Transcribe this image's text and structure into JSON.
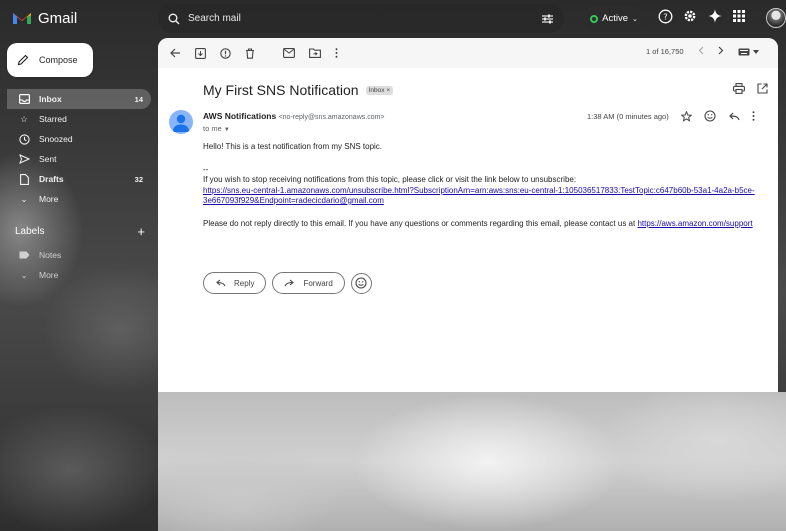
{
  "app": {
    "name": "Gmail"
  },
  "search": {
    "placeholder": "Search mail"
  },
  "status": {
    "label": "Active"
  },
  "sidebar": {
    "compose_label": "Compose",
    "items": [
      {
        "label": "Inbox",
        "count": "14"
      },
      {
        "label": "Starred",
        "count": ""
      },
      {
        "label": "Snoozed",
        "count": ""
      },
      {
        "label": "Sent",
        "count": ""
      },
      {
        "label": "Drafts",
        "count": "32"
      },
      {
        "label": "More",
        "count": ""
      }
    ],
    "labels_title": "Labels",
    "labels": [
      {
        "label": "Notes"
      },
      {
        "label": "More"
      }
    ]
  },
  "toolbar": {
    "pager": "1 of 16,750"
  },
  "email": {
    "subject": "My First SNS Notification",
    "badge": "Inbox",
    "badge_close": "×",
    "sender_name": "AWS Notifications",
    "sender_email": "<no-reply@sns.amazonaws.com>",
    "to": "to me",
    "time": "1:38 AM (0 minutes ago)",
    "body": {
      "line1": "Hello! This is a test notification from my SNS topic.",
      "separator": "--",
      "unsub_text": "If you wish to stop receiving notifications from this topic, please click or visit the link below to unsubscribe:",
      "unsub_link_1": "https://sns.eu-central-1.amazonaws.com/unsubscribe.html?SubscriptionArn=arn:aws:sns:eu-central-1:105036517833:TestTopic:c647b60b-53a1-4a2a-b5ce-",
      "unsub_link_2": "3e667093f929&Endpoint=radecicdario@gmail.com",
      "footer_text": "Please do not reply directly to this email. If you have any questions or comments regarding this email, please contact us at ",
      "footer_link": "https://aws.amazon.com/support"
    }
  },
  "actions": {
    "reply": "Reply",
    "forward": "Forward"
  },
  "colors": {
    "accent_link": "#1a0dab",
    "active_dot": "#34c759",
    "avatar": "#8ab4f8"
  }
}
